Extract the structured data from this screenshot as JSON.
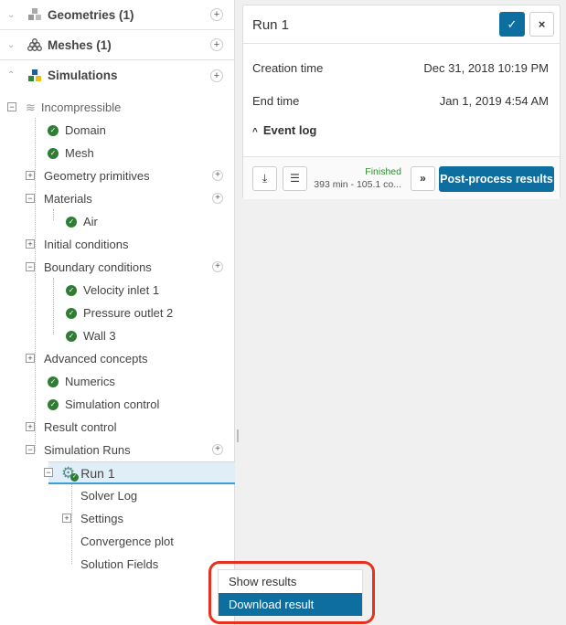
{
  "sections": [
    {
      "label": "Geometries (1)",
      "expanded": false
    },
    {
      "label": "Meshes (1)",
      "expanded": false
    },
    {
      "label": "Simulations",
      "expanded": true
    }
  ],
  "tree": {
    "incompressible": "Incompressible",
    "domain": "Domain",
    "mesh": "Mesh",
    "geometry_primitives": "Geometry primitives",
    "materials": "Materials",
    "air": "Air",
    "initial_conditions": "Initial conditions",
    "boundary_conditions": "Boundary conditions",
    "velocity_inlet": "Velocity inlet 1",
    "pressure_outlet": "Pressure outlet 2",
    "wall": "Wall 3",
    "advanced_concepts": "Advanced concepts",
    "numerics": "Numerics",
    "simulation_control": "Simulation control",
    "result_control": "Result control",
    "simulation_runs": "Simulation Runs",
    "run1": "Run 1",
    "solver_log": "Solver Log",
    "settings": "Settings",
    "convergence_plot": "Convergence plot",
    "solution_fields": "Solution Fields"
  },
  "card": {
    "title": "Run 1",
    "creation_label": "Creation time",
    "creation_value": "Dec 31, 2018 10:19 PM",
    "end_label": "End time",
    "end_value": "Jan 1, 2019 4:54 AM",
    "event_log": "Event log",
    "status": "Finished",
    "status_detail": "393 min - 105.1 co...",
    "postprocess": "Post-process results"
  },
  "menu": {
    "show": "Show results",
    "download": "Download result"
  },
  "colors": {
    "accent": "#0f6ea0",
    "success": "#2e7d32",
    "highlight": "#e8301e"
  }
}
